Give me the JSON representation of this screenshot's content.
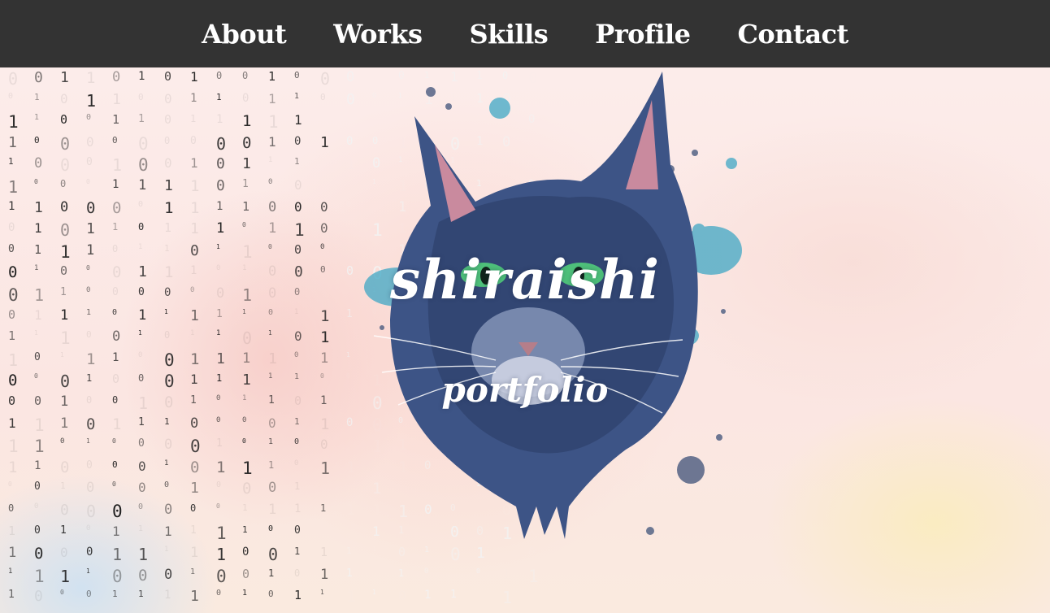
{
  "nav": {
    "items": [
      {
        "label": "About"
      },
      {
        "label": "Works"
      },
      {
        "label": "Skills"
      },
      {
        "label": "Profile"
      },
      {
        "label": "Contact"
      }
    ]
  },
  "hero": {
    "title": "shiraishi",
    "subtitle": "portfolio",
    "image": "watercolor-cat-illustration",
    "background_effect": "falling-binary-digits"
  },
  "colors": {
    "nav_bg": "#333333",
    "nav_text": "#ffffff",
    "hero_text": "#ffffff",
    "digit": "#1e1e1e",
    "cat_blue": "#3f5a8c",
    "splash_teal": "#3fa7c4"
  }
}
